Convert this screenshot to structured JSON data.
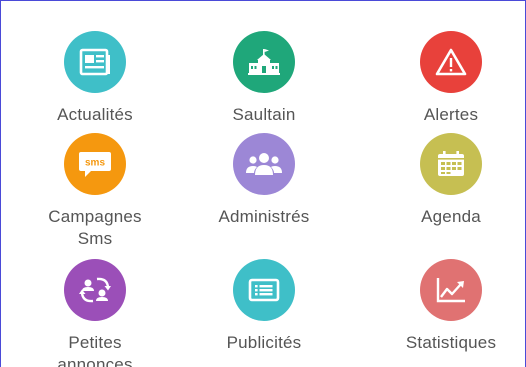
{
  "tiles": [
    {
      "id": "actualites",
      "label": "Actualités",
      "color": "#3fbfc8",
      "icon": "newspaper-icon"
    },
    {
      "id": "saultain",
      "label": "Saultain",
      "color": "#1fa77a",
      "icon": "town-hall-icon"
    },
    {
      "id": "alertes",
      "label": "Alertes",
      "color": "#e8413b",
      "icon": "warning-icon"
    },
    {
      "id": "campagnes-sms",
      "label_line1": "Campagnes",
      "label_line2": "Sms",
      "color": "#f5980f",
      "icon": "sms-bubble-icon",
      "icon_text": "sms"
    },
    {
      "id": "administres",
      "label": "Administrés",
      "color": "#9c87d6",
      "icon": "people-group-icon"
    },
    {
      "id": "agenda",
      "label": "Agenda",
      "color": "#c6bf52",
      "icon": "calendar-icon"
    },
    {
      "id": "petites-annonces",
      "label_line1": "Petites",
      "label_line2": "annonces",
      "color": "#9b4fb8",
      "icon": "exchange-users-icon"
    },
    {
      "id": "publicites",
      "label": "Publicités",
      "color": "#3fbfc8",
      "icon": "billboard-icon"
    },
    {
      "id": "statistiques",
      "label": "Statistiques",
      "color": "#e07272",
      "icon": "line-chart-icon"
    }
  ]
}
